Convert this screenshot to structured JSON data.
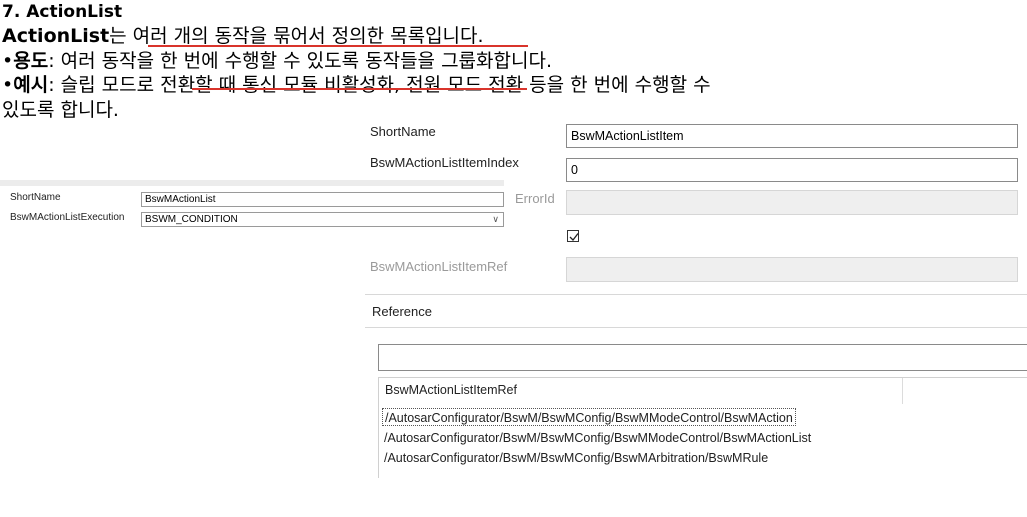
{
  "slide": {
    "heading": "7. ActionList",
    "line1_bold": "ActionList",
    "line1_rest": "는 여러 개의 동작을 묶어서 정의한 목록입니다.",
    "line2_bullet": "•",
    "line2_bold": "용도",
    "line2_rest": ": 여러 동작을 한 번에 수행할 수 있도록 동작들을 그룹화합니다.",
    "line3_bullet": "•",
    "line3_bold": "예시",
    "line3_rest": ": 슬립 모드로 전환할 때 통신 모듈 비활성화, 전원 모드 전환 등을 한 번에 수행할 수",
    "line4": "있도록 합니다."
  },
  "action_list_dialog": {
    "shortname_label": "ShortName",
    "shortname_value": "BswMActionList",
    "execution_label": "BswMActionListExecution",
    "execution_value": "BSWM_CONDITION"
  },
  "action_list_item_dialog": {
    "shortname_label": "ShortName",
    "shortname_value": "BswMActionListItem",
    "index_label": "BswMActionListItemIndex",
    "index_value": "0",
    "errorid_label": "ErrorId",
    "errorid_value": "",
    "checkbox_checked": true,
    "itemref_label": "BswMActionListItemRef",
    "itemref_value": ""
  },
  "reference_panel": {
    "title": "Reference",
    "search_value": "",
    "column_header": "BswMActionListItemRef",
    "items": [
      "/AutosarConfigurator/BswM/BswMConfig/BswMModeControl/BswMAction",
      "/AutosarConfigurator/BswM/BswMConfig/BswMModeControl/BswMActionList",
      "/AutosarConfigurator/BswM/BswMConfig/BswMArbitration/BswMRule"
    ],
    "selected_index": 0
  },
  "colors": {
    "underline": "#d9342b",
    "field_border": "#8a8a8a",
    "disabled_field": "#efefef"
  }
}
